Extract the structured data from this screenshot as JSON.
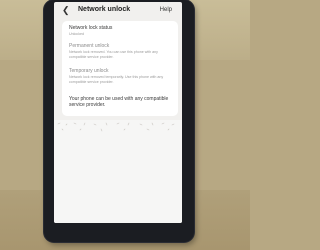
{
  "header": {
    "title": "Network unlock",
    "help_label": "Help",
    "back_icon": "chevron-left-icon"
  },
  "items": [
    {
      "title": "Network lock status",
      "subtitle": "Unlocked"
    },
    {
      "title": "Permanent unlock",
      "subtitle": "Network lock removed. You can use this phone with any compatible service provider."
    },
    {
      "title": "Temporary unlock",
      "subtitle": "Network lock removed temporarily. Use this phone with any compatible service provider."
    }
  ],
  "info": {
    "text": "Your phone can be used with any compatible service provider."
  },
  "colors": {
    "screen_bg": "#f1f0ee",
    "card_bg": "#ffffff",
    "phone_body": "#1b1d22",
    "table_bg": "#b7a883"
  }
}
